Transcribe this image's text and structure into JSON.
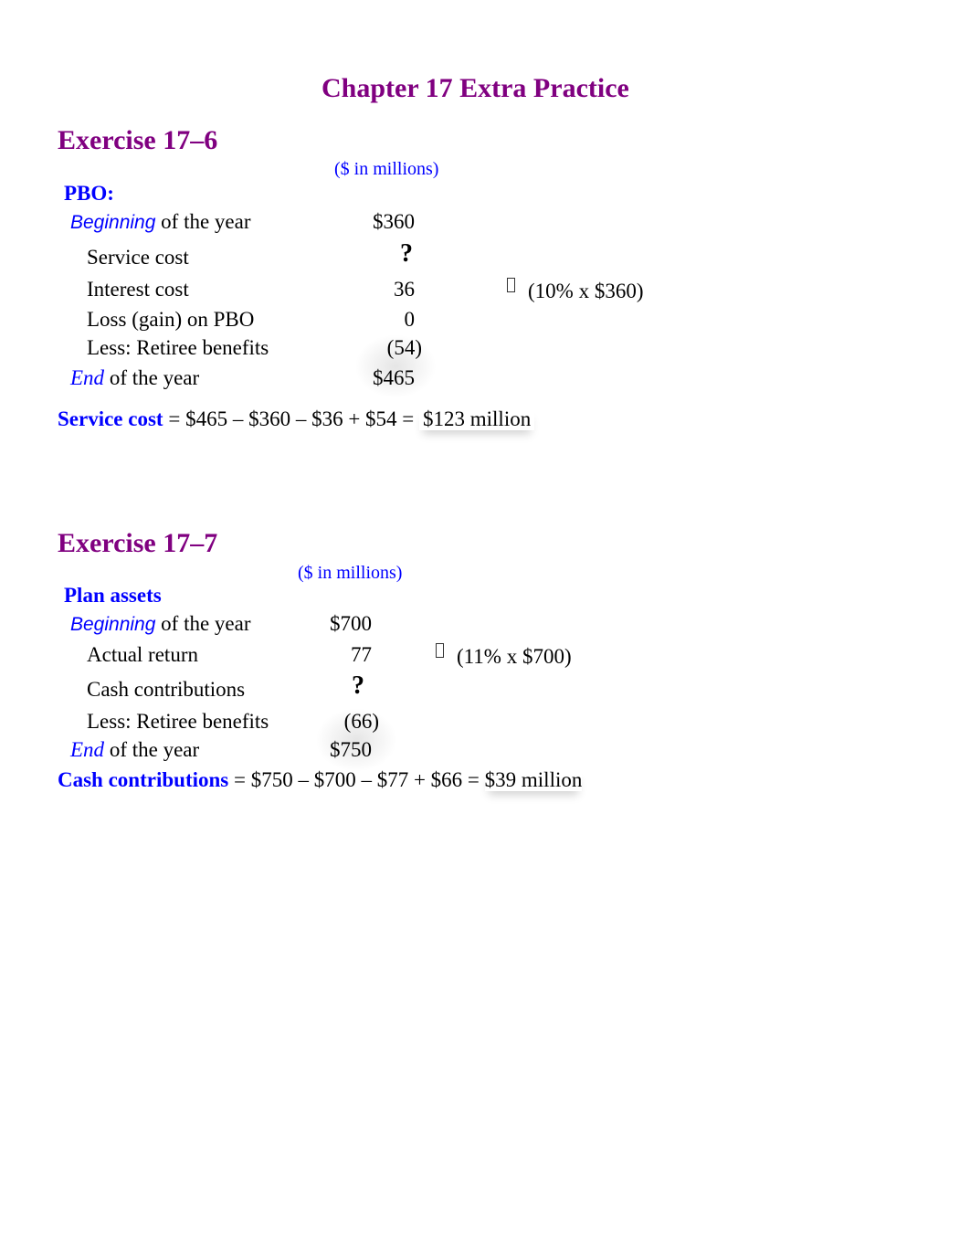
{
  "page_title": "Chapter 17 Extra Practice",
  "colors": {
    "title": "#800080",
    "accent": "#0000ff",
    "text": "#000000"
  },
  "exercise_6": {
    "title": "Exercise 17–6",
    "unit_label": "($ in millions)",
    "section_heading": "PBO:",
    "rows": [
      {
        "label_emph": "Beginning",
        "label_rest": " of the year",
        "value": "$360"
      },
      {
        "label": "Service cost",
        "value": "?"
      },
      {
        "label": "Interest cost",
        "value": "36",
        "note_icon": "missing-glyph-icon",
        "note": "(10% x $360)"
      },
      {
        "label": "Loss (gain) on PBO",
        "value": "0"
      },
      {
        "label": "Less: Retiree benefits",
        "value": "(54)"
      },
      {
        "label_emph": "End",
        "label_rest": " of the year",
        "value": "$465"
      }
    ],
    "formula": {
      "label": "Service cost",
      "expression": " = $465 – $360 – $36 + $54 = ",
      "result": "$123 million"
    }
  },
  "exercise_7": {
    "title": "Exercise 17–7",
    "unit_label": "($ in millions)",
    "section_heading": "Plan assets",
    "rows": [
      {
        "label_emph": "Beginning",
        "label_rest": " of the year",
        "value": "$700"
      },
      {
        "label": "Actual return",
        "value": "77",
        "note_icon": "missing-glyph-icon",
        "note": "(11% x $700)"
      },
      {
        "label": "Cash contributions",
        "value": "?"
      },
      {
        "label": "Less: Retiree benefits",
        "value": "(66)"
      },
      {
        "label_emph": "End",
        "label_rest": " of the year",
        "value": "$750"
      }
    ],
    "formula": {
      "label": "Cash contributions",
      "expression": " = $750 – $700 – $77 + $66 = ",
      "result": "$39 million"
    }
  }
}
